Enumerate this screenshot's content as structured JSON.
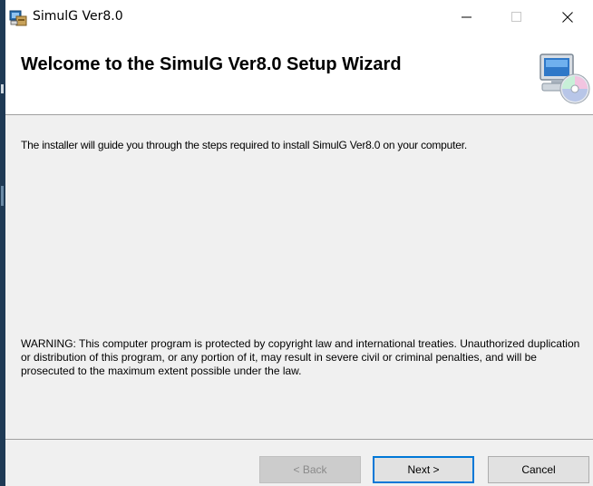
{
  "window": {
    "title": "SimulG Ver8.0",
    "icon": "installer-icon"
  },
  "header": {
    "title": "Welcome to the SimulG Ver8.0 Setup Wizard",
    "graphic": "computer-cd-icon"
  },
  "body": {
    "intro": "The installer will guide you through the steps required to install SimulG Ver8.0 on your computer.",
    "warning": "WARNING: This computer program is protected by copyright law and international treaties. Unauthorized duplication or distribution of this program, or any portion of it, may result in severe civil or criminal penalties, and will be prosecuted to the maximum extent possible under the law."
  },
  "buttons": {
    "back": "< Back",
    "next": "Next >",
    "cancel": "Cancel"
  },
  "colors": {
    "accent": "#0078d7",
    "panel": "#f0f0f0"
  }
}
